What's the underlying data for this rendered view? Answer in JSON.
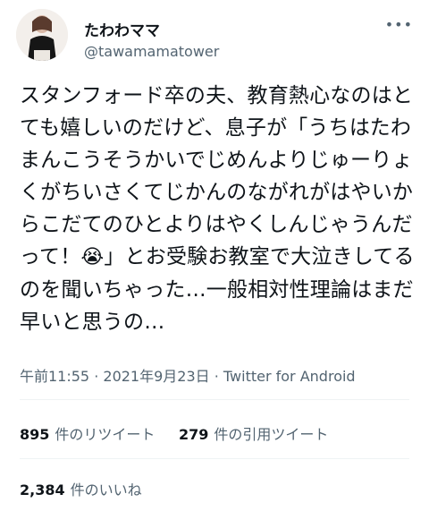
{
  "user": {
    "display_name": "たわわママ",
    "handle": "@tawamamatower",
    "more_icon": "ellipsis-icon"
  },
  "tweet": {
    "text": "スタンフォード卒の夫、教育熱心なのはとても嬉しいのだけど、息子が「うちはたわまんこうそうかいでじめんよりじゅーりょくがちいさくてじかんのながれがはやいからこだてのひとよりはやくしんじゃうんだって！",
    "emoji": "😭",
    "text_after": "」とお受験お教室で大泣きしてるのを聞いちゃった…一般相対性理論はまだ早いと思うの…",
    "time": "午前11:55",
    "date": "2021年9月23日",
    "source": "Twitter for Android"
  },
  "stats": {
    "retweets": "895",
    "retweets_label": "件のリツイート",
    "quotes": "279",
    "quotes_label": "件の引用ツイート",
    "likes": "2,384",
    "likes_label": "件のいいね"
  }
}
